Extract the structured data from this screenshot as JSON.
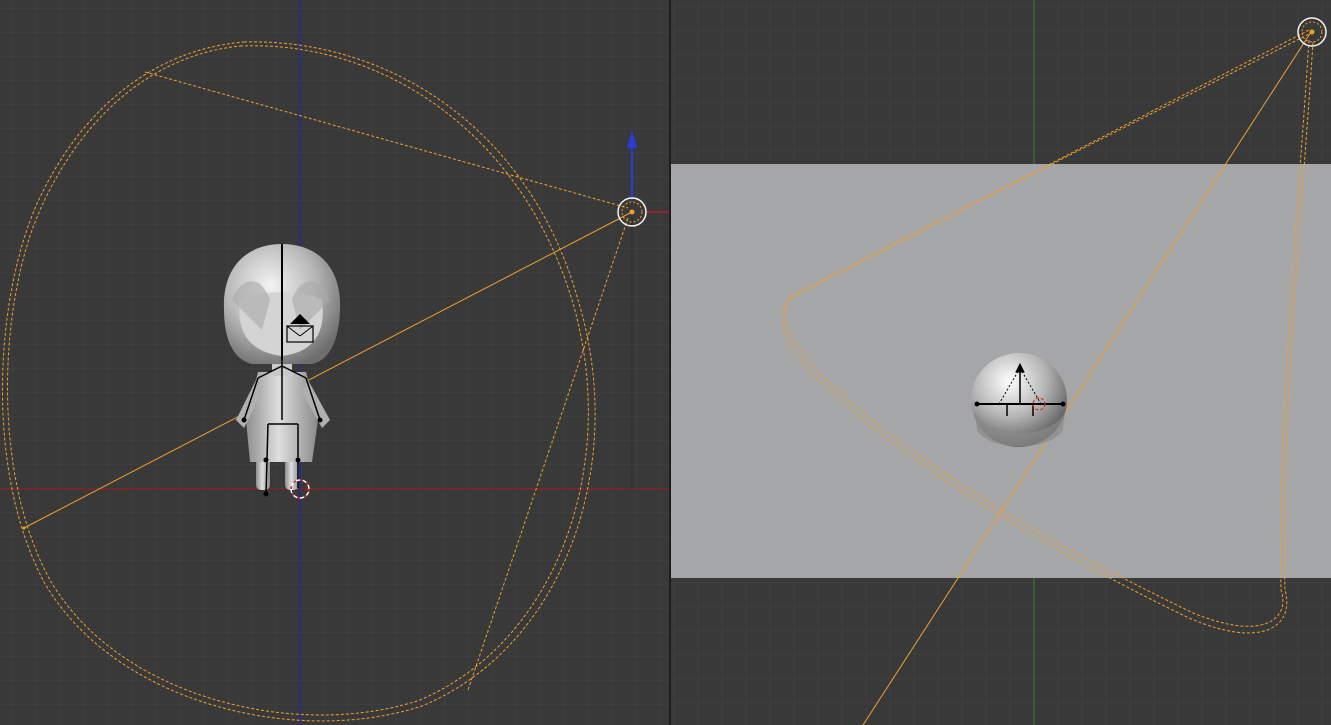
{
  "app": "Blender",
  "colors": {
    "viewport_bg": "#393939",
    "grid_line": "#434343",
    "axis_x": "#8a1f1f",
    "axis_y": "#2e7d2e",
    "axis_z": "#2424b0",
    "light_wire": "#f0a030",
    "lamp_line": "#f0a030",
    "camera_view_plane": "#a5a6a8",
    "mesh": "#c9c9c9",
    "armature": "#000000"
  },
  "viewports": [
    {
      "name": "front-ortho",
      "objects": [
        "character-mesh",
        "armature",
        "spot-lamp",
        "3d-cursor",
        "transform-gizmo-z"
      ]
    },
    {
      "name": "camera-view",
      "objects": [
        "camera-frame",
        "character-mesh",
        "armature",
        "spot-lamp"
      ]
    }
  ]
}
